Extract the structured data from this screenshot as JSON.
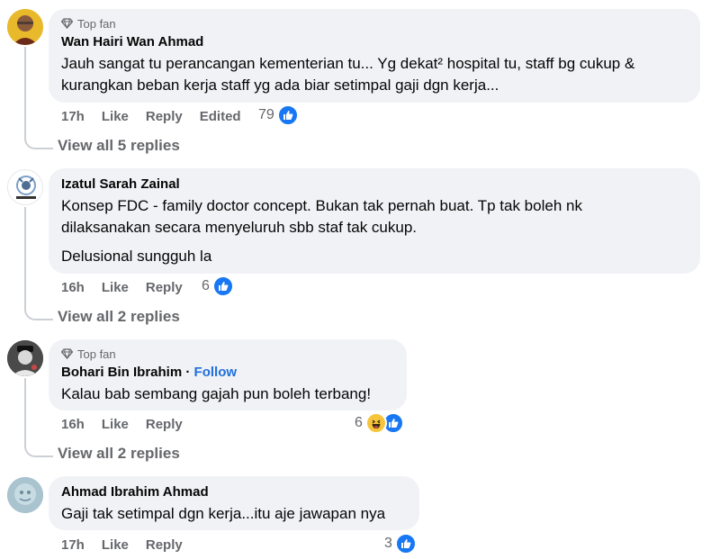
{
  "comments": [
    {
      "badge": "Top fan",
      "author": "Wan Hairi Wan Ahmad",
      "follow": "",
      "text": [
        "Jauh sangat tu perancangan kementerian tu... Yg dekat² hospital tu, staff bg cukup &",
        "kurangkan beban kerja staff yg ada biar setimpal gaji dgn kerja..."
      ],
      "time": "17h",
      "like": "Like",
      "reply": "Reply",
      "edited": "Edited",
      "reaction_count": "79",
      "view_replies": "View all 5 replies"
    },
    {
      "badge": "",
      "author": "Izatul Sarah Zainal",
      "follow": "",
      "text": [
        "Konsep FDC - family doctor concept. Bukan tak pernah buat. Tp tak boleh nk",
        "dilaksanakan secara menyeluruh sbb staf tak cukup.",
        "Delusional sungguh la"
      ],
      "time": "16h",
      "like": "Like",
      "reply": "Reply",
      "edited": "",
      "reaction_count": "6",
      "view_replies": "View all 2 replies"
    },
    {
      "badge": "Top fan",
      "author": "Bohari Bin Ibrahim",
      "follow": "Follow",
      "text": [
        "Kalau bab sembang gajah pun boleh terbang!"
      ],
      "time": "16h",
      "like": "Like",
      "reply": "Reply",
      "edited": "",
      "reaction_count": "6",
      "view_replies": "View all 2 replies"
    },
    {
      "badge": "",
      "author": "Ahmad Ibrahim Ahmad",
      "follow": "",
      "text": [
        "Gaji tak setimpal dgn kerja...itu aje jawapan nya"
      ],
      "time": "17h",
      "like": "Like",
      "reply": "Reply",
      "edited": "",
      "reaction_count": "3",
      "view_replies": ""
    }
  ],
  "colors": {
    "bubble": "#f0f2f5",
    "meta_text": "#65676b",
    "like_blue": "#1877f2",
    "follow_blue": "#216fdb"
  }
}
